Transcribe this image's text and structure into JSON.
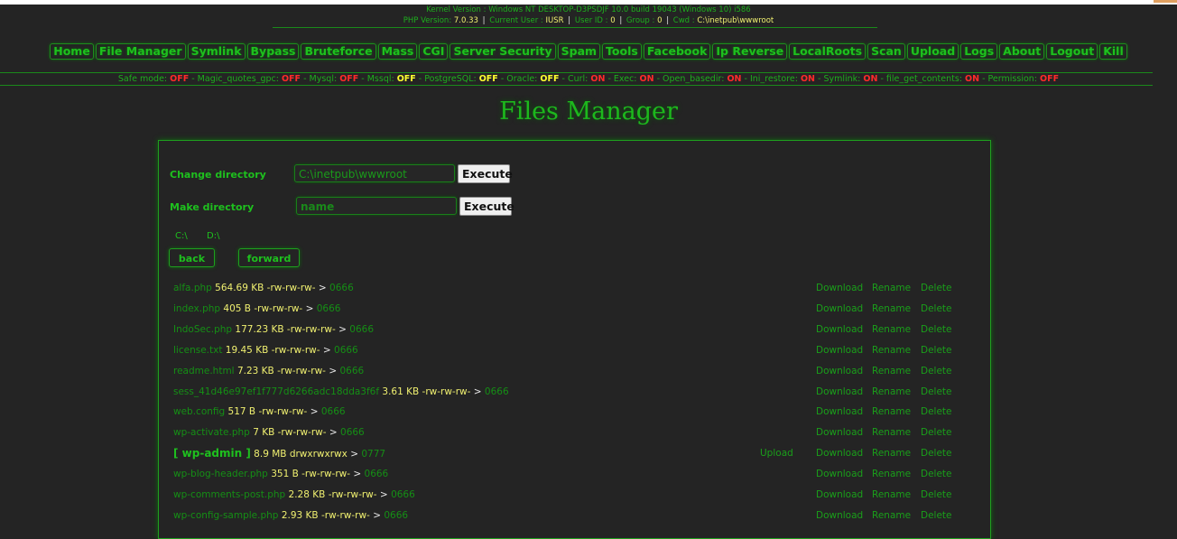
{
  "server_info": {
    "kernel_label": "Kernel Version :",
    "kernel_value": "Windows NT DESKTOP-D3PSDJF 10.0 build 19043 (Windows 10) i586",
    "php_label": "PHP Version:",
    "php_value": "7.0.33",
    "user_label": "Current User :",
    "user_value": "IUSR",
    "uid_label": "User ID :",
    "uid_value": "0",
    "group_label": "Group :",
    "group_value": "0",
    "cwd_label": "Cwd :",
    "cwd_value": "C:\\inetpub\\wwwroot",
    "separator": "|"
  },
  "nav": [
    "Home",
    "File Manager",
    "Symlink",
    "Bypass",
    "Bruteforce",
    "Mass",
    "CGI",
    "Server Security",
    "Spam",
    "Tools",
    "Facebook",
    "Ip Reverse",
    "LocalRoots",
    "Scan",
    "Upload",
    "Logs",
    "About",
    "Logout",
    "Kill"
  ],
  "status": [
    {
      "label": "Safe mode:",
      "value": "OFF",
      "type": "off"
    },
    {
      "label": "Magic_quotes_gpc:",
      "value": "OFF",
      "type": "off"
    },
    {
      "label": "Mysql:",
      "value": "OFF",
      "type": "off"
    },
    {
      "label": "Mssql:",
      "value": "OFF",
      "type": "yoff"
    },
    {
      "label": "PostgreSQL:",
      "value": "OFF",
      "type": "yoff"
    },
    {
      "label": "Oracle:",
      "value": "OFF",
      "type": "yoff"
    },
    {
      "label": "Curl:",
      "value": "ON",
      "type": "on"
    },
    {
      "label": "Exec:",
      "value": "ON",
      "type": "on"
    },
    {
      "label": "Open_basedir:",
      "value": "ON",
      "type": "on"
    },
    {
      "label": "Ini_restore:",
      "value": "ON",
      "type": "on"
    },
    {
      "label": "Symlink:",
      "value": "ON",
      "type": "on"
    },
    {
      "label": "file_get_contents:",
      "value": "ON",
      "type": "on"
    },
    {
      "label": "Permission:",
      "value": "OFF",
      "type": "off"
    }
  ],
  "status_sep": " - ",
  "title": "Files Manager",
  "forms": {
    "chdir_label": "Change directory",
    "chdir_value": "C:\\inetpub\\wwwroot",
    "chdir_button": "Execute",
    "mkdir_label": "Make directory",
    "mkdir_placeholder": "name",
    "mkdir_button": "Execute"
  },
  "drives": [
    "C:\\",
    "D:\\"
  ],
  "nav_buttons": {
    "back": "back",
    "forward": "forward"
  },
  "actions": {
    "upload": "Upload",
    "download": "Download",
    "rename": "Rename",
    "delete": "Delete"
  },
  "files": [
    {
      "name": "alfa.php",
      "size": "564.69 KB",
      "perm": "-rw-rw-rw-",
      "arrow": ">",
      "octal": "0666",
      "dir": false
    },
    {
      "name": "index.php",
      "size": "405 B",
      "perm": "-rw-rw-rw-",
      "arrow": ">",
      "octal": "0666",
      "dir": false
    },
    {
      "name": "IndoSec.php",
      "size": "177.23 KB",
      "perm": "-rw-rw-rw-",
      "arrow": ">",
      "octal": "0666",
      "dir": false
    },
    {
      "name": "license.txt",
      "size": "19.45 KB",
      "perm": "-rw-rw-rw-",
      "arrow": ">",
      "octal": "0666",
      "dir": false
    },
    {
      "name": "readme.html",
      "size": "7.23 KB",
      "perm": "-rw-rw-rw-",
      "arrow": ">",
      "octal": "0666",
      "dir": false
    },
    {
      "name": "sess_41d46e97ef1f777d6266adc18dda3f6f",
      "size": "3.61 KB",
      "perm": "-rw-rw-rw-",
      "arrow": ">",
      "octal": "0666",
      "dir": false
    },
    {
      "name": "web.config",
      "size": "517 B",
      "perm": "-rw-rw-rw-",
      "arrow": ">",
      "octal": "0666",
      "dir": false
    },
    {
      "name": "wp-activate.php",
      "size": "7 KB",
      "perm": "-rw-rw-rw-",
      "arrow": ">",
      "octal": "0666",
      "dir": false
    },
    {
      "name": "[ wp-admin ]",
      "size": "8.9 MB",
      "perm": "drwxrwxrwx",
      "arrow": ">",
      "octal": "0777",
      "dir": true
    },
    {
      "name": "wp-blog-header.php",
      "size": "351 B",
      "perm": "-rw-rw-rw-",
      "arrow": ">",
      "octal": "0666",
      "dir": false
    },
    {
      "name": "wp-comments-post.php",
      "size": "2.28 KB",
      "perm": "-rw-rw-rw-",
      "arrow": ">",
      "octal": "0666",
      "dir": false
    },
    {
      "name": "wp-config-sample.php",
      "size": "2.93 KB",
      "perm": "-rw-rw-rw-",
      "arrow": ">",
      "octal": "0666",
      "dir": false
    }
  ]
}
